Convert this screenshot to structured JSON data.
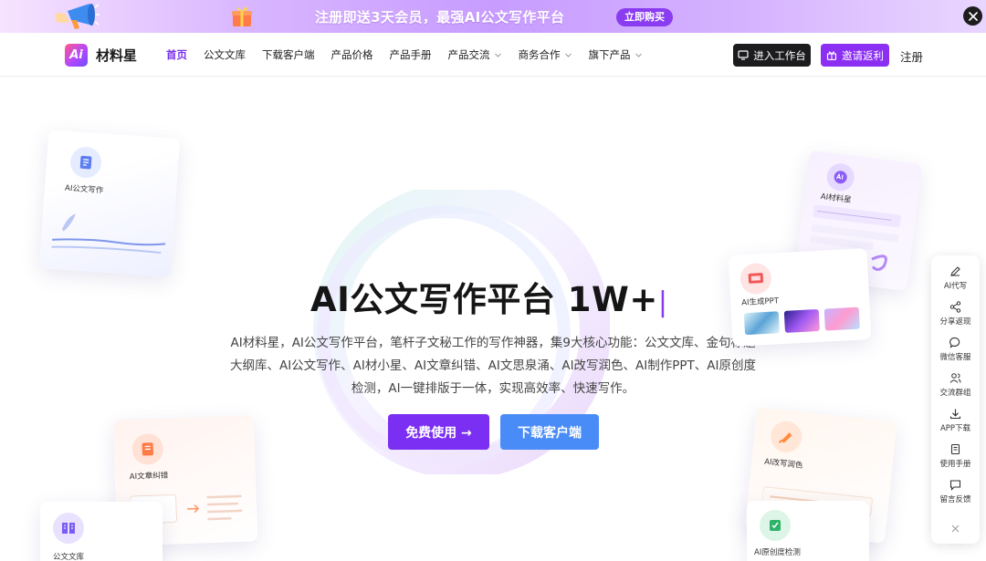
{
  "promo": {
    "text": "注册即送3天会员，最强AI公文写作平台",
    "buy_label": "立即购买",
    "icons": [
      "megaphone-icon",
      "gift-icon",
      "close-icon"
    ]
  },
  "nav": {
    "logo_text": "材料星",
    "logo_mark": "Ai",
    "items": [
      {
        "label": "首页",
        "active": true
      },
      {
        "label": "公文文库"
      },
      {
        "label": "下载客户端"
      },
      {
        "label": "产品价格"
      },
      {
        "label": "产品手册"
      },
      {
        "label": "产品交流",
        "dropdown": true
      },
      {
        "label": "商务合作",
        "dropdown": true
      },
      {
        "label": "旗下产品",
        "dropdown": true
      }
    ],
    "workbench_label": "进入工作台",
    "invite_label": "邀请返利",
    "register_label": "注册"
  },
  "hero": {
    "title": "AI公文写作平台 1W+",
    "caret": "|",
    "description": "AI材料星，AI公文写作平台，笔杆子文秘工作的写作神器，集9大核心功能：公文文库、金句标题大纲库、AI公文写作、AI材小星、AI文章纠错、AI文思泉涌、AI改写润色、AI制作PPT、AI原创度检测，AI一键排版于一体，实现高效率、快速写作。",
    "free_button": "免费使用 →",
    "download_button": "下载客户端"
  },
  "cards": {
    "writing": "AI公文写作",
    "ai_star": "AI材料星",
    "ppt": "AI生成PPT",
    "correct": "AI文章纠错",
    "library": "公文文库",
    "polish": "AI改写润色",
    "original": "AI原创度检测"
  },
  "sidebar": {
    "items": [
      {
        "label": "AI代写",
        "icon": "pen-icon"
      },
      {
        "label": "分享返现",
        "icon": "share-icon"
      },
      {
        "label": "微信客服",
        "icon": "chat-icon"
      },
      {
        "label": "交流群组",
        "icon": "group-icon"
      },
      {
        "label": "APP下载",
        "icon": "download-icon"
      },
      {
        "label": "使用手册",
        "icon": "manual-icon"
      },
      {
        "label": "留言反馈",
        "icon": "feedback-icon"
      }
    ],
    "close_icon": "close-icon"
  },
  "colors": {
    "brand_purple": "#7b2ff2",
    "brand_blue": "#4a8cf7",
    "workbench_dark": "#1c1c1e"
  }
}
